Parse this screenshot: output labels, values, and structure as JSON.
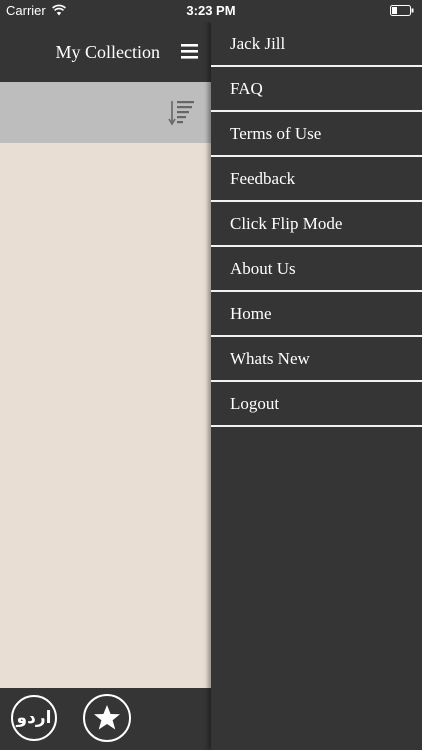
{
  "status_bar": {
    "carrier": "Carrier",
    "time": "3:23 PM",
    "wifi_icon": "wifi-icon",
    "battery_icon": "battery-icon"
  },
  "nav_bar": {
    "title": "My Collection",
    "menu_icon": "hamburger-icon"
  },
  "toolbar": {
    "sort_icon": "sort-icon"
  },
  "tab_bar": {
    "urdu_label": "اردو",
    "favorite_icon": "star-icon"
  },
  "side_menu": {
    "items": [
      {
        "label": "Jack Jill"
      },
      {
        "label": "FAQ"
      },
      {
        "label": "Terms of Use"
      },
      {
        "label": "Feedback"
      },
      {
        "label": "Click Flip Mode"
      },
      {
        "label": "About Us"
      },
      {
        "label": "Home"
      },
      {
        "label": "Whats New"
      },
      {
        "label": "Logout"
      }
    ]
  },
  "colors": {
    "dark_bar": "#353535",
    "toolbar_gray": "#bdbdbd",
    "content_background": "#e9ded4",
    "separator": "#f2f2f2",
    "text": "#ffffff"
  }
}
